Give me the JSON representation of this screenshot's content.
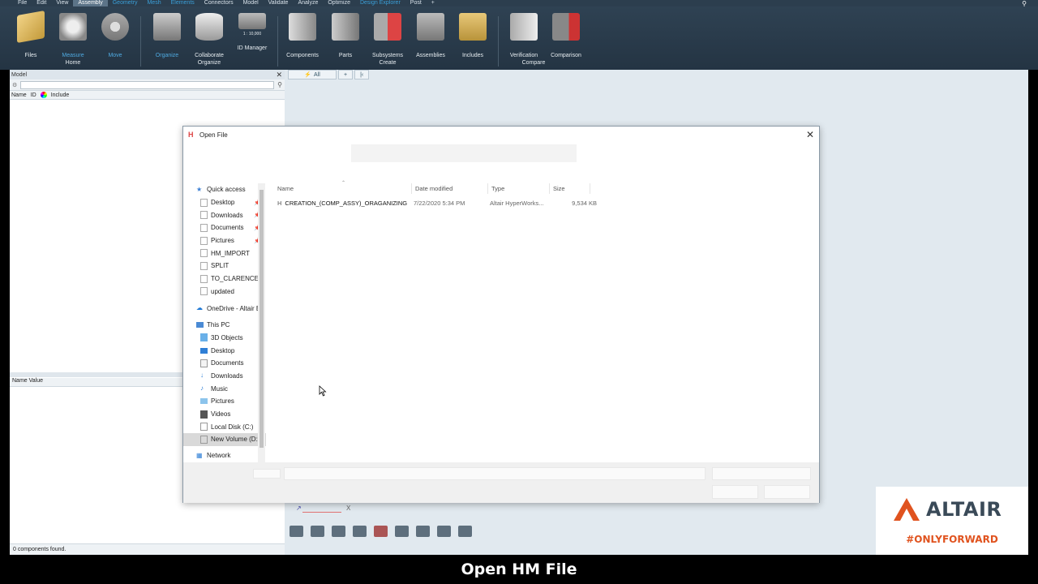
{
  "menubar": {
    "items": [
      "File",
      "Edit",
      "View",
      "Assembly",
      "Geometry",
      "Mesh",
      "Elements",
      "Connectors",
      "Model",
      "Validate",
      "Analyze",
      "Optimize",
      "Design Explorer",
      "Post",
      "+"
    ]
  },
  "ribbon": {
    "buttons": [
      {
        "label": "Files",
        "sub": ""
      },
      {
        "label": "Measure",
        "sub": "Home"
      },
      {
        "label": "Move",
        "sub": ""
      },
      {
        "label": "Organize",
        "sub": ""
      },
      {
        "label": "Collaborate",
        "sub": "Organize"
      },
      {
        "label": "ID Manager",
        "sub": ""
      },
      {
        "label": "Components",
        "sub": ""
      },
      {
        "label": "Parts",
        "sub": ""
      },
      {
        "label": "Subsystems",
        "sub": "Create"
      },
      {
        "label": "Assemblies",
        "sub": ""
      },
      {
        "label": "Includes",
        "sub": ""
      },
      {
        "label": "Verification",
        "sub": "Compare"
      },
      {
        "label": "Comparison",
        "sub": ""
      }
    ],
    "id_manager_caption": "1 : 10,000"
  },
  "left_panel": {
    "title": "Model",
    "columns": [
      "Name",
      "ID",
      "Include"
    ],
    "props_header": "Name Value",
    "status": "0 components found."
  },
  "main": {
    "tab_all": "All",
    "tab_add": "+",
    "axis_label": "X"
  },
  "dialog": {
    "title": "Open File",
    "nav": {
      "quick_access": "Quick access",
      "quick_items": [
        "Desktop",
        "Downloads",
        "Documents",
        "Pictures",
        "HM_IMPORT",
        "SPLIT",
        "TO_CLARENCE",
        "updated"
      ],
      "onedrive": "OneDrive - Altair E",
      "this_pc": "This PC",
      "pc_items": [
        "3D Objects",
        "Desktop",
        "Documents",
        "Downloads",
        "Music",
        "Pictures",
        "Videos",
        "Local Disk (C:)",
        "New Volume (D:"
      ],
      "network": "Network"
    },
    "columns": {
      "name": "Name",
      "date": "Date modified",
      "type": "Type",
      "size": "Size"
    },
    "files": [
      {
        "name": "CREATION_(COMP_ASSY)_ORAGANIZING",
        "date": "7/22/2020 5:34 PM",
        "type": "Altair HyperWorks...",
        "size": "9,534 KB"
      }
    ]
  },
  "branding": {
    "logo_text": "ALTAIR",
    "tagline": "#ONLYFORWARD",
    "accent": "#e0531f"
  },
  "caption": "Open HM File"
}
